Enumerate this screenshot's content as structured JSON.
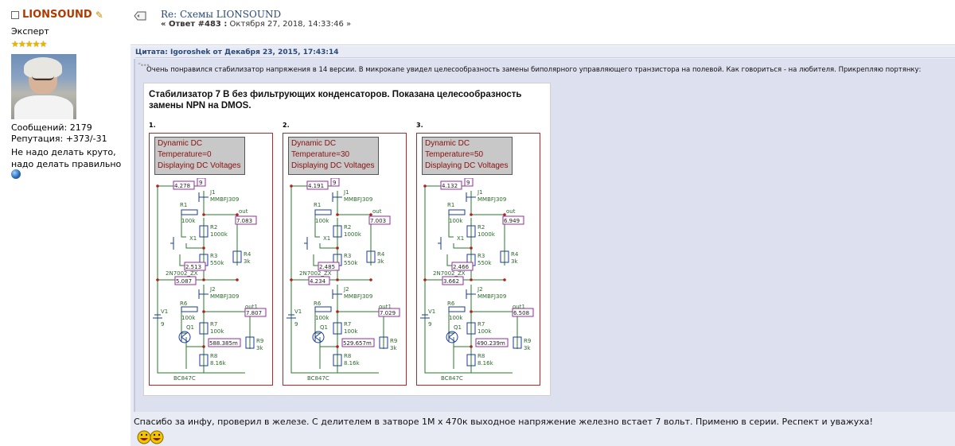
{
  "user": {
    "name": "LIONSOUND",
    "rank": "Эксперт",
    "stars": "★★★★★",
    "posts": "Сообщений: 2179",
    "reputation": "Репутация: +373/-31",
    "motto_line1": "Не надо делать круто,",
    "motto_line2": "надо делать правильно"
  },
  "post": {
    "title": "Re: Схемы LIONSOUND",
    "meta_prefix": "« Ответ #483 :",
    "meta_date": "Октября 27, 2018, 14:33:46 »",
    "quote_header": "Цитата: Igoroshek от Декабря 23, 2015, 17:43:14",
    "quote_text": "Очень понравился стабилизатор напряжения в 14 версии. В микрокапе увидел целесообразность замены биполярного управляющего транзистора на полевой. Как говориться - на любителя. Прикрепляю портянку:",
    "reply_text": "Спасибо за инфу, проверил в железе. С делителем в затворе 1М х 470к выходное напряжение железно встает 7 вольт. Применю в серии. Респект и уважуха!"
  },
  "figure": {
    "title": "Стабилизатор 7 В без фильтрующих конденсаторов. Показана целесообразность замены NPN на DMOS.",
    "panels": [
      {
        "num": "1.",
        "l1": "Dynamic DC",
        "l2": "Temperature=0",
        "l3": "Displaying DC Voltages",
        "v_j1": "4.278",
        "v_x1": "2.513",
        "v_out": "7.083",
        "v_j2": "5.087",
        "v_out1": "7.807",
        "v_q1": "588.385m"
      },
      {
        "num": "2.",
        "l1": "Dynamic DC",
        "l2": "Temperature=30",
        "l3": "Displaying DC Voltages",
        "v_j1": "4.191",
        "v_x1": "2.485",
        "v_out": "7.003",
        "v_j2": "4.234",
        "v_out1": "7.029",
        "v_q1": "529.657m"
      },
      {
        "num": "3.",
        "l1": "Dynamic DC",
        "l2": "Temperature=50",
        "l3": "Displaying DC Voltages",
        "v_j1": "4.132",
        "v_x1": "2.466",
        "v_out": "6.949",
        "v_j2": "3.662",
        "v_out1": "6.508",
        "v_q1": "490.239m"
      }
    ],
    "labels": {
      "g9": "9",
      "j1": "J1",
      "mmbf": "MMBFJ309",
      "r1": "R1",
      "k100": "100k",
      "r2": "R2",
      "k1000": "1000k",
      "x1": "X1",
      "r3": "R3",
      "k550": "550k",
      "r4": "R4",
      "k3": "3k",
      "out": "out",
      "n2n": "2N7002_ZX",
      "j2": "J2",
      "r6": "R6",
      "v1": "V1",
      "r7": "R7",
      "q1": "Q1",
      "r9": "R9",
      "r8": "R8",
      "k816": "8.16k",
      "bc": "BC847C",
      "out1": "out1"
    }
  }
}
